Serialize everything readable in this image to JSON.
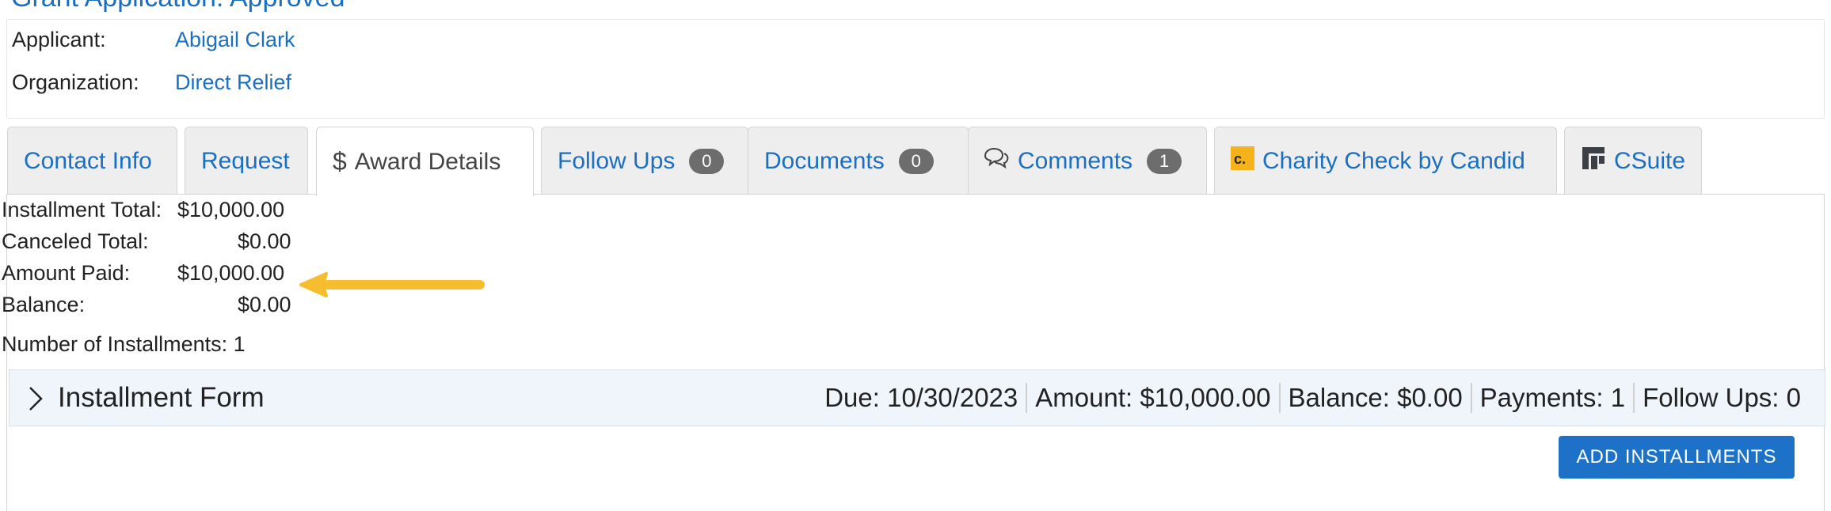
{
  "header": {
    "partial_title": "Grant Application: Approved"
  },
  "applicant": {
    "applicant_label": "Applicant:",
    "applicant_name": "Abigail Clark",
    "org_label": "Organization:",
    "org_name": "Direct Relief"
  },
  "tabs": [
    {
      "label": "Contact Info"
    },
    {
      "label": "Request"
    },
    {
      "label": "Award Details",
      "active": true
    },
    {
      "label": "Follow Ups",
      "badge": "0"
    },
    {
      "label": "Documents",
      "badge": "0"
    },
    {
      "label": "Comments",
      "badge": "1"
    },
    {
      "label": "Charity Check by Candid"
    },
    {
      "label": "CSuite"
    }
  ],
  "summary": {
    "installment_total_label": "Installment Total:",
    "installment_total_value": "$10,000.00",
    "canceled_total_label": "Canceled Total:",
    "canceled_total_value": "$0.00",
    "amount_paid_label": "Amount Paid:",
    "amount_paid_value": "$10,000.00",
    "balance_label": "Balance:",
    "balance_value": "$0.00",
    "num_installments": "Number of Installments: 1"
  },
  "installment": {
    "title": "Installment Form",
    "due": "Due: 10/30/2023",
    "amount": "Amount: $10,000.00",
    "balance": "Balance: $0.00",
    "payments": "Payments: 1",
    "follow_ups": "Follow Ups: 0"
  },
  "actions": {
    "add_installments": "ADD INSTALLMENTS"
  },
  "colors": {
    "link": "#1a6fc2",
    "button": "#1d72c7",
    "arrow": "#f6be2f",
    "badge": "#6d6d6d"
  },
  "icons": [
    "dollar-icon",
    "comments-icon",
    "candid-logo-icon",
    "csuite-logo-icon",
    "chevron-right-icon",
    "arrow-left-icon"
  ]
}
